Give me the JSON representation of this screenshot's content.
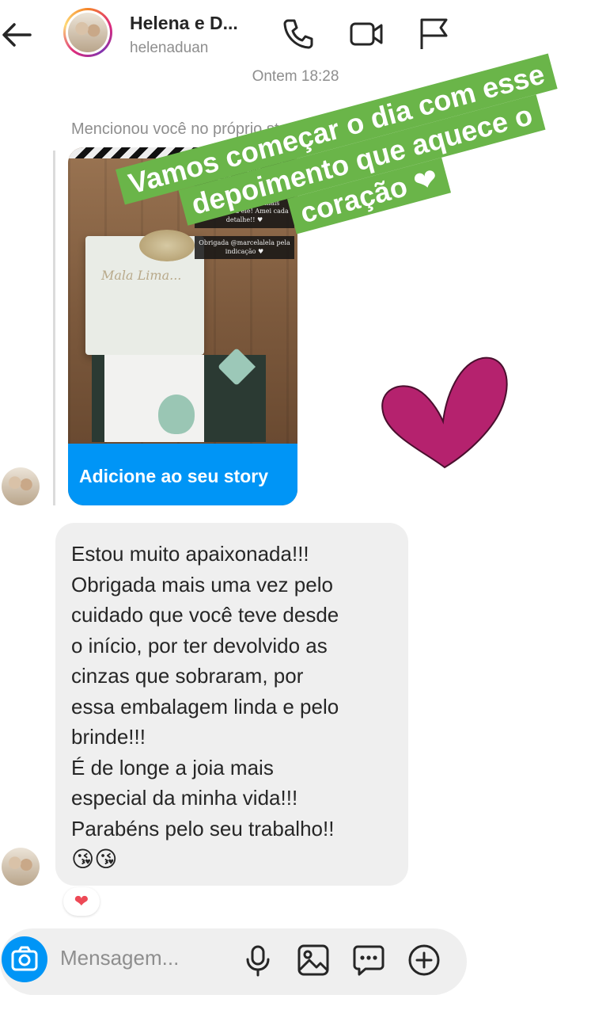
{
  "header": {
    "title": "Helena e D...",
    "username": "helenaduan",
    "icons": [
      "back-arrow-icon",
      "phone-icon",
      "video-icon",
      "flag-icon"
    ]
  },
  "thread": {
    "timestamp": "Ontem 18:28",
    "story_mention": {
      "label": "Mencionou você no próprio story",
      "story_text": "Obrigada pelo capricho, cuidado e delicadeza. Você conseguiu eternizar em uma joia o amor da vida! Agora vou carregá-lo para onde eu for e me sentirei mais conectada a ele! Amei cada detalhe!! ♥",
      "story_credit": "Obrigada @marcelalela pela indicação ♥",
      "box_script": "Mala Lima...",
      "button_label": "Adicione ao seu story"
    },
    "message": {
      "lines": [
        "Estou muito apaixonada!!!",
        "Obrigada mais uma vez pelo",
        "cuidado que você teve desde",
        "o início, por ter devolvido as",
        "cinzas que sobraram, por",
        "essa embalagem linda e pelo",
        "brinde!!!",
        "É de longe a joia mais",
        "especial da minha vida!!!",
        "Parabéns pelo seu trabalho!!"
      ],
      "emojis": "😘😘",
      "reaction": "❤"
    }
  },
  "composer": {
    "placeholder": "Mensagem...",
    "icons": [
      "camera-icon",
      "microphone-icon",
      "gallery-icon",
      "sticker-icon",
      "plus-icon"
    ]
  },
  "overlay": {
    "banner_lines": [
      "Vamos começar o dia com esse",
      "depoimento que aquece o",
      "coração ❤"
    ],
    "banner_color": "#6ab549",
    "heart_color": "#b5226e"
  },
  "colors": {
    "accent": "#0095f6",
    "bubble": "#efefef",
    "muted_text": "#8e8e8e"
  }
}
